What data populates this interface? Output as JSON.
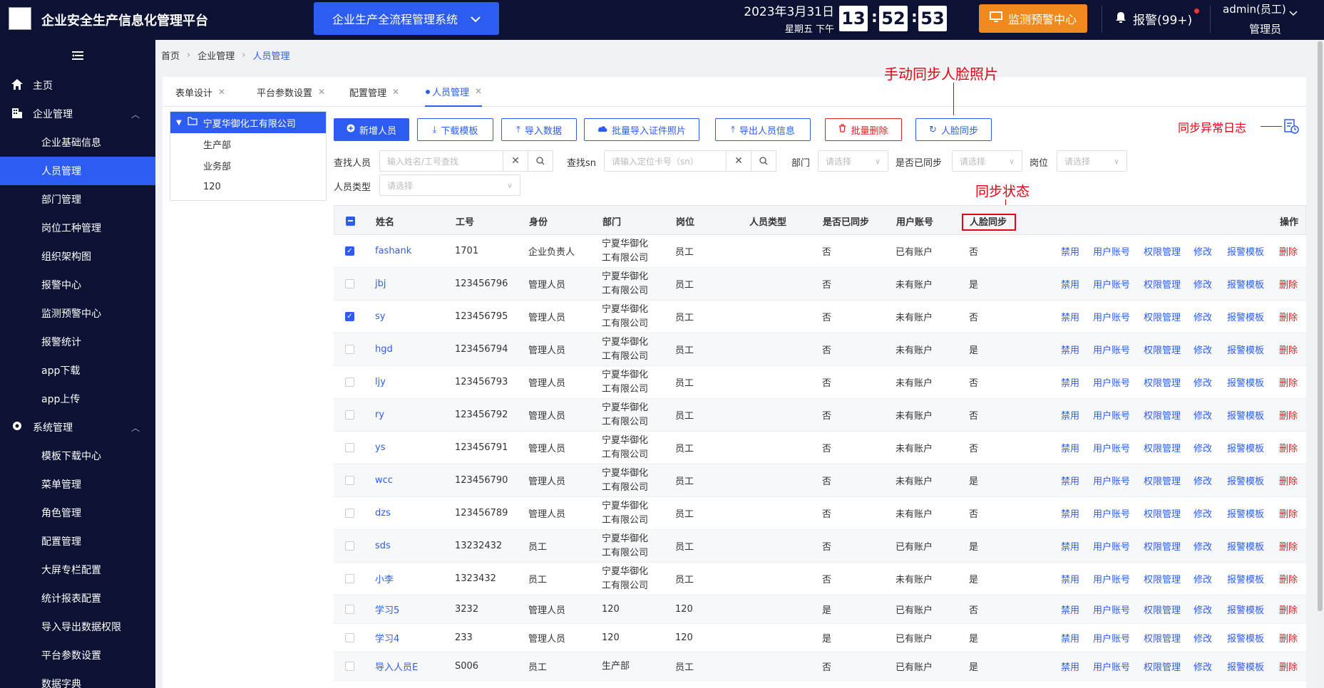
{
  "header": {
    "app_title": "企业安全生产信息化管理平台",
    "system_select": "企业生产全流程管理系统",
    "date": "2023年3月31日",
    "weekday": "星期五  下午",
    "hour": "13",
    "minute": "52",
    "second": "53",
    "monitor_button": "监测预警中心",
    "alarm_label": "报警(99+)",
    "user_name": "admin(员工)",
    "user_role": "管理员"
  },
  "sidebar": {
    "home": "主页",
    "enterprise_group": "企业管理",
    "enterprise_items": [
      "企业基础信息",
      "人员管理",
      "部门管理",
      "岗位工种管理",
      "组织架构图",
      "报警中心",
      "监测预警中心",
      "报警统计",
      "app下载",
      "app上传"
    ],
    "system_group": "系统管理",
    "system_items": [
      "模板下载中心",
      "菜单管理",
      "角色管理",
      "配置管理",
      "大屏专栏配置",
      "统计报表配置",
      "导入导出数据权限",
      "平台参数设置",
      "数据字典"
    ]
  },
  "breadcrumb": [
    "首页",
    "企业管理",
    "人员管理"
  ],
  "tabs": [
    "表单设计",
    "平台参数设置",
    "配置管理",
    "人员管理"
  ],
  "tree": {
    "root": "宁夏华御化工有限公司",
    "children": [
      "生产部",
      "业务部",
      "120"
    ]
  },
  "toolbar": {
    "add": "新增人员",
    "download_template": "下载模板",
    "import_data": "导入数据",
    "batch_import_photos": "批量导入证件照片",
    "export": "导出人员信息",
    "batch_delete": "批量删除",
    "face_sync": "人脸同步"
  },
  "annotations": {
    "manual_sync": "手动同步人脸照片",
    "sync_error_log": "同步异常日志",
    "sync_status": "同步状态"
  },
  "filters": {
    "search_person_label": "查找人员",
    "search_person_placeholder": "输入姓名/工号查找",
    "search_sn_label": "查找sn",
    "search_sn_placeholder": "请输入定位卡号（sn）",
    "dept_label": "部门",
    "synced_label": "是否已同步",
    "post_label": "岗位",
    "type_label": "人员类型",
    "select_placeholder": "请选择"
  },
  "table": {
    "headers": [
      "姓名",
      "工号",
      "身份",
      "部门",
      "岗位",
      "人员类型",
      "是否已同步",
      "用户账号",
      "人脸同步",
      "操作"
    ],
    "actions": [
      "禁用",
      "用户账号",
      "权限管理",
      "修改",
      "报警模板",
      "删除"
    ],
    "rows": [
      {
        "checked": true,
        "name": "fashank",
        "no": "1701",
        "role": "企业负责人",
        "dept1": "宁夏华御化",
        "dept2": "工有限公司",
        "post": "员工",
        "synced": "否",
        "account": "已有账户",
        "face": "否"
      },
      {
        "checked": false,
        "name": "jbj",
        "no": "123456796",
        "role": "管理人员",
        "dept1": "宁夏华御化",
        "dept2": "工有限公司",
        "post": "员工",
        "synced": "否",
        "account": "未有账户",
        "face": "是"
      },
      {
        "checked": true,
        "name": "sy",
        "no": "123456795",
        "role": "管理人员",
        "dept1": "宁夏华御化",
        "dept2": "工有限公司",
        "post": "员工",
        "synced": "否",
        "account": "未有账户",
        "face": "否"
      },
      {
        "checked": false,
        "name": "hgd",
        "no": "123456794",
        "role": "管理人员",
        "dept1": "宁夏华御化",
        "dept2": "工有限公司",
        "post": "员工",
        "synced": "否",
        "account": "未有账户",
        "face": "是"
      },
      {
        "checked": false,
        "name": "ljy",
        "no": "123456793",
        "role": "管理人员",
        "dept1": "宁夏华御化",
        "dept2": "工有限公司",
        "post": "员工",
        "synced": "否",
        "account": "未有账户",
        "face": "否"
      },
      {
        "checked": false,
        "name": "ry",
        "no": "123456792",
        "role": "管理人员",
        "dept1": "宁夏华御化",
        "dept2": "工有限公司",
        "post": "员工",
        "synced": "否",
        "account": "未有账户",
        "face": "否"
      },
      {
        "checked": false,
        "name": "ys",
        "no": "123456791",
        "role": "管理人员",
        "dept1": "宁夏华御化",
        "dept2": "工有限公司",
        "post": "员工",
        "synced": "否",
        "account": "未有账户",
        "face": "否"
      },
      {
        "checked": false,
        "name": "wcc",
        "no": "123456790",
        "role": "管理人员",
        "dept1": "宁夏华御化",
        "dept2": "工有限公司",
        "post": "员工",
        "synced": "否",
        "account": "未有账户",
        "face": "是"
      },
      {
        "checked": false,
        "name": "dzs",
        "no": "123456789",
        "role": "管理人员",
        "dept1": "宁夏华御化",
        "dept2": "工有限公司",
        "post": "员工",
        "synced": "否",
        "account": "未有账户",
        "face": "否"
      },
      {
        "checked": false,
        "name": "sds",
        "no": "13232432",
        "role": "员工",
        "dept1": "宁夏华御化",
        "dept2": "工有限公司",
        "post": "员工",
        "synced": "否",
        "account": "已有账户",
        "face": "是"
      },
      {
        "checked": false,
        "name": "小李",
        "no": "1323432",
        "role": "员工",
        "dept1": "宁夏华御化",
        "dept2": "工有限公司",
        "post": "员工",
        "synced": "否",
        "account": "未有账户",
        "face": "是"
      },
      {
        "checked": false,
        "name": "学习5",
        "no": "3232",
        "role": "管理人员",
        "dept1": "120",
        "dept2": "",
        "post": "120",
        "synced": "是",
        "account": "已有账户",
        "face": "否"
      },
      {
        "checked": false,
        "name": "学习4",
        "no": "233",
        "role": "管理人员",
        "dept1": "120",
        "dept2": "",
        "post": "120",
        "synced": "是",
        "account": "已有账户",
        "face": "是"
      },
      {
        "checked": false,
        "name": "导入人员E",
        "no": "S006",
        "role": "员工",
        "dept1": "生产部",
        "dept2": "",
        "post": "员工",
        "synced": "否",
        "account": "已有账户",
        "face": "是"
      }
    ]
  },
  "colors": {
    "primary": "#2d5cf0",
    "header_bg": "#0b1233",
    "orange": "#f08a1c",
    "danger": "#e02020",
    "annotation": "#e60012"
  }
}
